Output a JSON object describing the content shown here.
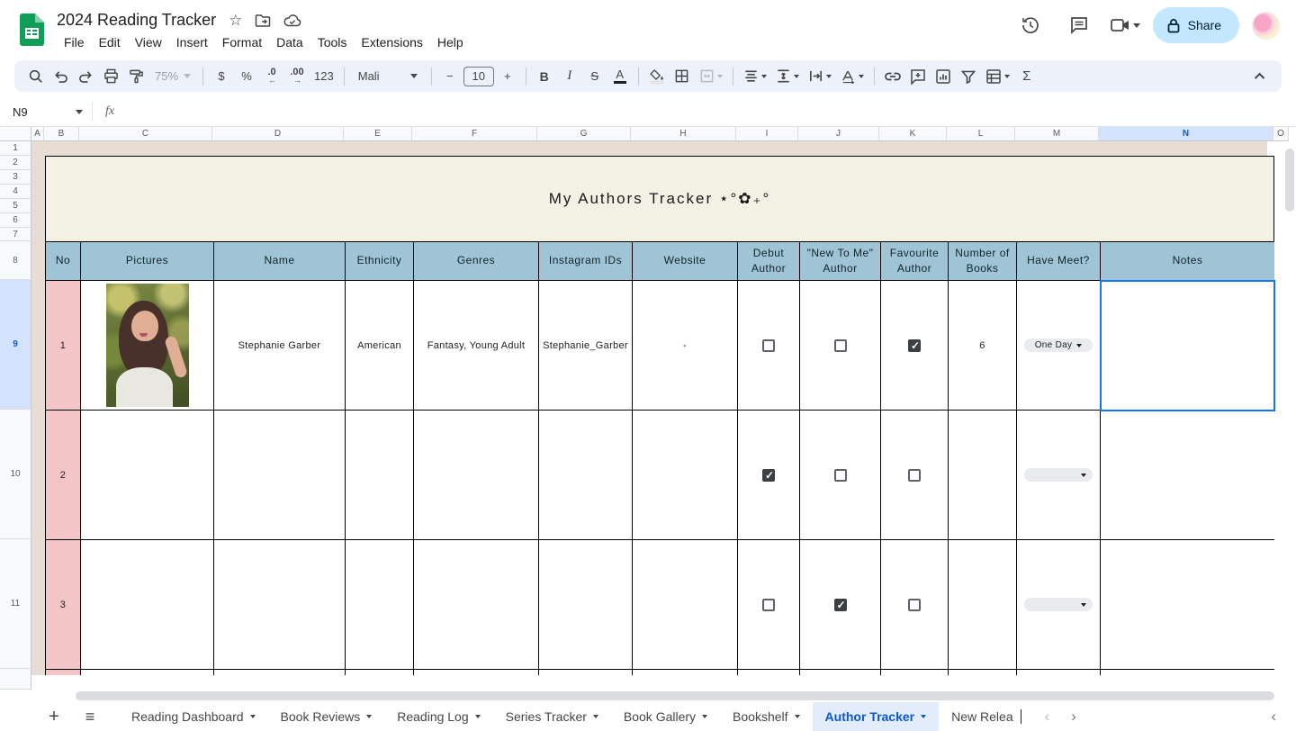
{
  "titlebar": {
    "doc_title": "2024 Reading Tracker",
    "menu_items": [
      "File",
      "Edit",
      "View",
      "Insert",
      "Format",
      "Data",
      "Tools",
      "Extensions",
      "Help"
    ],
    "share_label": "Share"
  },
  "toolbar": {
    "zoom_value": "75%",
    "currency_label": "$",
    "percent_label": "%",
    "decrease_decimal_label": ".0",
    "increase_decimal_label": ".00",
    "number_format_label": "123",
    "font_name": "Mali",
    "minus_label": "−",
    "font_size": "10",
    "plus_label": "+",
    "bold_label": "B",
    "italic_label": "I",
    "strikethrough_label": "S",
    "text_color_label": "A",
    "functions_label": "Σ"
  },
  "formula_bar": {
    "cell_ref": "N9",
    "fx_label": "fx"
  },
  "grid": {
    "column_letters": [
      "A",
      "B",
      "C",
      "D",
      "E",
      "F",
      "G",
      "H",
      "I",
      "J",
      "K",
      "L",
      "M",
      "N",
      "O"
    ],
    "selected_column": "N",
    "row_numbers": [
      "1",
      "2",
      "3",
      "4",
      "5",
      "6",
      "7",
      "8",
      "9",
      "10",
      "11"
    ],
    "selected_row": "9"
  },
  "table": {
    "banner_title": "My Authors Tracker ⋆°✿₊°",
    "headers": [
      "No",
      "Pictures",
      "Name",
      "Ethnicity",
      "Genres",
      "Instagram IDs",
      "Website",
      "Debut Author",
      "\"New To Me\" Author",
      "Favourite Author",
      "Number of Books",
      "Have Meet?",
      "Notes"
    ],
    "rows": [
      {
        "no": "1",
        "name": "Stephanie Garber",
        "ethnicity": "American",
        "genres": "Fantasy, Young Adult",
        "instagram": "Stephanie_Garber",
        "website": "-",
        "debut_author": false,
        "new_to_me_author": false,
        "favourite_author": true,
        "number_of_books": "6",
        "have_meet": "One Day",
        "notes": ""
      },
      {
        "no": "2",
        "name": "",
        "ethnicity": "",
        "genres": "",
        "instagram": "",
        "website": "",
        "debut_author": true,
        "new_to_me_author": false,
        "favourite_author": false,
        "number_of_books": "",
        "have_meet": "",
        "notes": ""
      },
      {
        "no": "3",
        "name": "",
        "ethnicity": "",
        "genres": "",
        "instagram": "",
        "website": "",
        "debut_author": false,
        "new_to_me_author": true,
        "favourite_author": false,
        "number_of_books": "",
        "have_meet": "",
        "notes": ""
      }
    ]
  },
  "tabs": {
    "sheets": [
      {
        "label": "Reading Dashboard",
        "active": false
      },
      {
        "label": "Book Reviews",
        "active": false
      },
      {
        "label": "Reading Log",
        "active": false
      },
      {
        "label": "Series Tracker",
        "active": false
      },
      {
        "label": "Book Gallery",
        "active": false
      },
      {
        "label": "Bookshelf",
        "active": false
      },
      {
        "label": "Author Tracker",
        "active": true
      },
      {
        "label": "New Relea",
        "active": false
      }
    ]
  },
  "icons": {
    "star": "☆",
    "plus": "+",
    "hamburger": "≡",
    "chevron_left": "‹",
    "chevron_right": "›",
    "check": "✓"
  },
  "colors": {
    "accent_blue": "#0b57d0",
    "selection_blue": "#1a73e8",
    "table_header_fill": "#9ec4d6",
    "no_column_pink": "#f3c5c6",
    "banner_cream": "#f3f1e4",
    "outside_gutter_tan": "#e8ddd3",
    "share_button_bg": "#c2e7ff",
    "active_tab_bg": "#e3ecfb"
  }
}
